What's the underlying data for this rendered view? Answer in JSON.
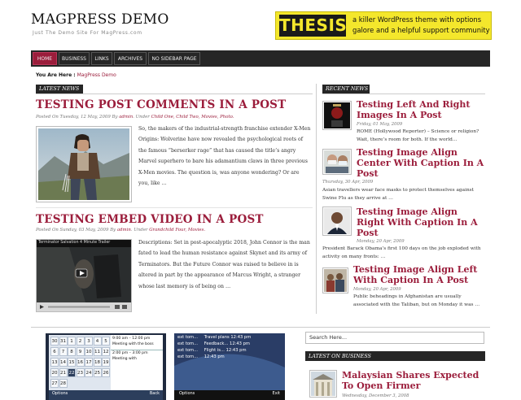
{
  "site": {
    "title": "MAGPRESS DEMO",
    "tagline": "Just The Demo Site For MagPress.com"
  },
  "ad": {
    "logo": "THESIS",
    "text": "a killer WordPress theme with options galore and a helpful support community"
  },
  "nav": {
    "items": [
      "HOME",
      "BUSINESS",
      "LINKS",
      "ARCHIVES",
      "NO SIDEBAR PAGE"
    ]
  },
  "breadcrumb": {
    "prefix": "You Are Here :",
    "current": "MagPress Demo"
  },
  "latest_news": {
    "label": "LATEST NEWS",
    "posts": [
      {
        "title": "TESTING POST COMMENTS IN A POST",
        "meta_prefix": "Posted On Tuesday, 12 May, 2009 By",
        "author": "admin",
        "meta_under": ". Under",
        "categories": "Child One, Child Two, Movies, Photo.",
        "excerpt": "So, the makers of the industrial-strength franchise extender X-Men Origins: Wolverine have now revealed the psychological roots of the famous “berserker rage” that has caused the title’s angry Marvel superhero to bare his adamantium claws in three previous X-Men movies. The question is, was anyone wondering? Or are you, like …"
      },
      {
        "title": "TESTING EMBED VIDEO IN A POST",
        "meta_prefix": "Posted On Sunday, 03 May, 2009 By",
        "author": "admin",
        "meta_under": ". Under",
        "categories": "Grandchild Four, Movies.",
        "video_title": "Terminator Salvation 4 Minute Trailer",
        "excerpt": "Descriptions: Set in post-apocalyptic 2018, John Connor is the man fated to lead the human resistance against Skynet and its army of Terminators. But the Future Connor was raised to believe in is altered in part by the appearance of Marcus Wright, a stranger whose last memory is of being on …"
      }
    ]
  },
  "recent_news": {
    "label": "RECENT NEWS",
    "items": [
      {
        "title": "Testing Left And Right Images In A Post",
        "date": "Friday, 01 May, 2009",
        "excerpt": "ROME (Hollywood Reporter) – Science or religion? Wait, there’s room for both. If the world…"
      },
      {
        "title": "Testing Image Align Center With Caption In A Post",
        "date": "Thursday, 30 Apr, 2009",
        "excerpt": "Asian travellers wear face masks to protect themselves against Swine Flu as they arrive at …"
      },
      {
        "title": "Testing Image Align Right With Caption In A Post",
        "date": "Monday, 20 Apr, 2009",
        "excerpt": "President Barack Obama’s first 100 days on the job exploded with activity on many fronts: …"
      },
      {
        "title": "Testing Image Align Left With Caption In A Post",
        "date": "Monday, 20 Apr, 2009",
        "excerpt": "Public beheadings in Afghanistan are usually associated with the Taliban, but on Monday it was …"
      }
    ]
  },
  "phones": {
    "calendar_days": [
      "30",
      "31",
      "1",
      "2",
      "3",
      "4",
      "5",
      "6",
      "7",
      "8",
      "9",
      "10",
      "11",
      "12",
      "13",
      "14",
      "15",
      "16",
      "17",
      "18",
      "19",
      "20",
      "21",
      "22",
      "23",
      "24",
      "25",
      "26",
      "27",
      "28"
    ],
    "events": [
      "9:00 am – 12:00 pm",
      "Meeting with the boss",
      "2:00 pm – 3:00 pm",
      "Meeting with"
    ],
    "softkey_left": "Options",
    "softkey_right": "Back",
    "messages": [
      {
        "from": "Travel plans 12:43 pm",
        "body": "ext tom..."
      },
      {
        "from": "Feedback... 12:43 pm",
        "body": "ext tom..."
      },
      {
        "from": "Flight is... 12:43 pm",
        "body": "ext tom..."
      },
      {
        "from": "12:43 pm",
        "body": "ext tom..."
      }
    ],
    "softkey2_left": "Options",
    "softkey2_right": "Exit"
  },
  "search": {
    "placeholder": "Search Here..."
  },
  "latest_business": {
    "label": "LATEST ON BUSINESS",
    "title": "Malaysian Shares Expected To Open Firmer",
    "date": "Wednesday, December 3, 2008"
  }
}
